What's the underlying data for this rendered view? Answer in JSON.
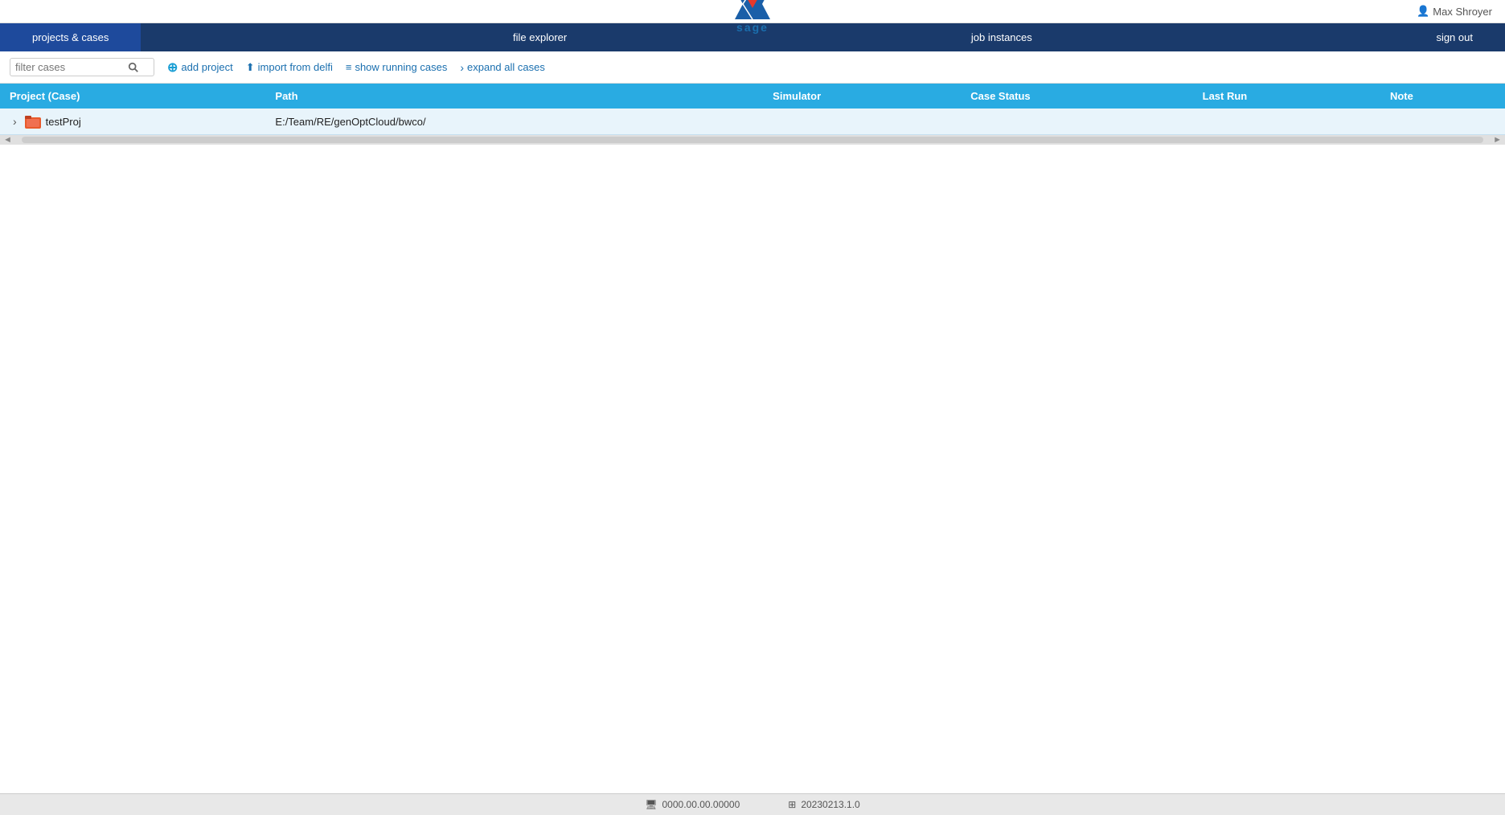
{
  "app": {
    "logo_text": "sage",
    "user": "Max Shroyer"
  },
  "nav": {
    "items": [
      {
        "id": "projects-cases",
        "label": "projects & cases",
        "active": true
      },
      {
        "id": "file-explorer",
        "label": "file explorer",
        "active": false
      },
      {
        "id": "job-instances",
        "label": "job instances",
        "active": false
      },
      {
        "id": "sign-out",
        "label": "sign out",
        "active": false
      }
    ]
  },
  "toolbar": {
    "filter_placeholder": "filter cases",
    "add_project_label": "add project",
    "import_label": "import from delfi",
    "show_running_label": "show running cases",
    "expand_all_label": "expand all cases"
  },
  "table": {
    "columns": [
      {
        "id": "project-case",
        "label": "Project (Case)"
      },
      {
        "id": "path",
        "label": "Path"
      },
      {
        "id": "simulator",
        "label": "Simulator"
      },
      {
        "id": "case-status",
        "label": "Case Status"
      },
      {
        "id": "last-run",
        "label": "Last Run"
      },
      {
        "id": "note",
        "label": "Note"
      }
    ],
    "rows": [
      {
        "project": "testProj",
        "path": "E:/Team/RE/genOptCloud/bwco/",
        "simulator": "",
        "case_status": "",
        "last_run": "",
        "note": ""
      }
    ]
  },
  "footer": {
    "version_label": "0000.00.00.00000",
    "build_label": "20230213.1.0"
  },
  "icons": {
    "search": "🔍",
    "user": "👤",
    "add": "+",
    "import_arrow": "⬆",
    "filter_lines": "≡",
    "chevron_right": ">",
    "monitor": "🖥",
    "grid": "⊞",
    "expand_arrow": "›"
  }
}
